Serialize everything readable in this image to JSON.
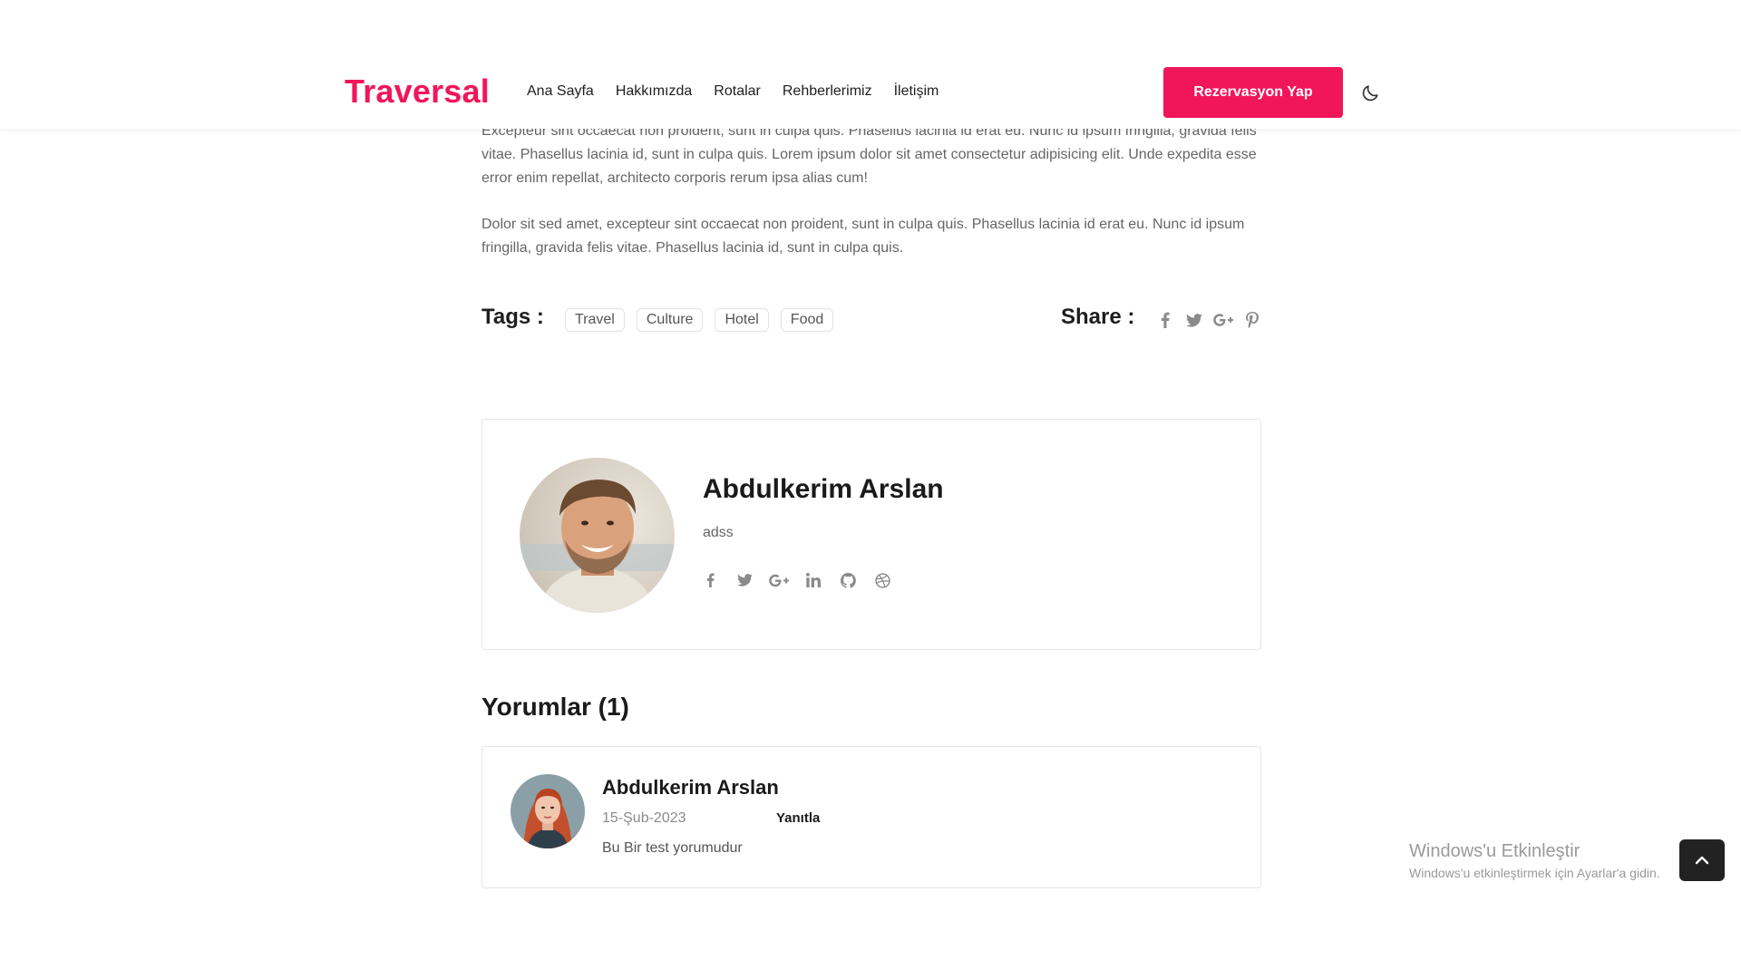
{
  "header": {
    "brand": "Traversal",
    "nav": [
      "Ana Sayfa",
      "Hakkımızda",
      "Rotalar",
      "Rehberlerimiz",
      "İletişim"
    ],
    "cta_label": "Rezervasyon Yap",
    "theme_icon": "moon-icon",
    "brand_color": "#f1155a"
  },
  "article": {
    "paragraphs": [
      "Excepteur sint occaecat non proident, sunt in culpa quis. Phasellus lacinia id erat eu. Nunc id ipsum fringilla, gravida felis vitae. Phasellus lacinia id, sunt in culpa quis. Lorem ipsum dolor sit amet consectetur adipisicing elit. Unde expedita esse error enim repellat, architecto corporis rerum ipsa alias cum!",
      "Dolor sit sed amet, excepteur sint occaecat non proident, sunt in culpa quis. Phasellus lacinia id erat eu. Nunc id ipsum fringilla, gravida felis vitae. Phasellus lacinia id, sunt in culpa quis."
    ],
    "tags_title": "Tags :",
    "tags": [
      "Travel",
      "Culture",
      "Hotel",
      "Food"
    ],
    "share_title": "Share :",
    "share_icons": [
      "facebook-icon",
      "twitter-icon",
      "google-plus-icon",
      "pinterest-icon"
    ]
  },
  "author": {
    "name": "Abdulkerim Arslan",
    "bio": "adss",
    "social_icons": [
      "facebook-icon",
      "twitter-icon",
      "google-plus-icon",
      "linkedin-icon",
      "github-icon",
      "dribbble-icon"
    ]
  },
  "comments": {
    "title": "Yorumlar (1)",
    "items": [
      {
        "author": "Abdulkerim Arslan",
        "date": "15-Şub-2023",
        "reply_label": "Yanıtla",
        "text": "Bu Bir test yorumudur"
      }
    ]
  },
  "watermark": {
    "title": "Windows'u Etkinleştir",
    "subtitle": "Windows'u etkinleştirmek için Ayarlar'a gidin."
  },
  "back_to_top_icon": "chevron-up-icon"
}
